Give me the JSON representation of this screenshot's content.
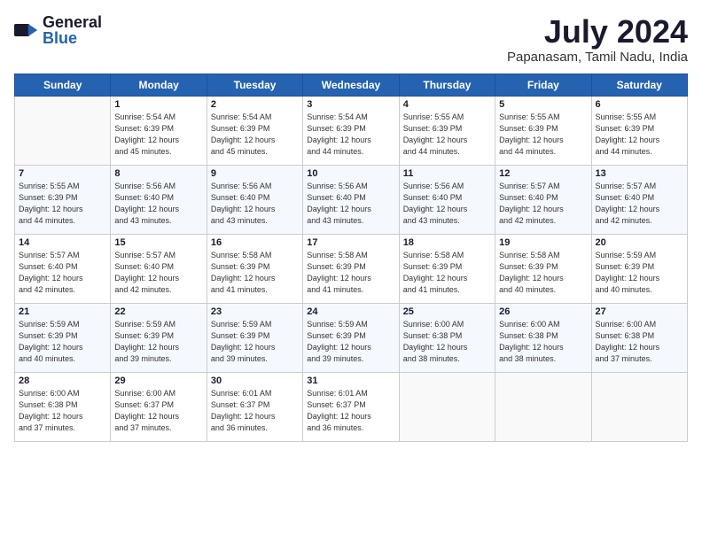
{
  "header": {
    "logo_general": "General",
    "logo_blue": "Blue",
    "month_title": "July 2024",
    "location": "Papanasam, Tamil Nadu, India"
  },
  "days_of_week": [
    "Sunday",
    "Monday",
    "Tuesday",
    "Wednesday",
    "Thursday",
    "Friday",
    "Saturday"
  ],
  "weeks": [
    [
      {
        "day": null
      },
      {
        "day": 1,
        "sunrise": "Sunrise: 5:54 AM",
        "sunset": "Sunset: 6:39 PM",
        "daylight": "Daylight: 12 hours and 45 minutes."
      },
      {
        "day": 2,
        "sunrise": "Sunrise: 5:54 AM",
        "sunset": "Sunset: 6:39 PM",
        "daylight": "Daylight: 12 hours and 45 minutes."
      },
      {
        "day": 3,
        "sunrise": "Sunrise: 5:54 AM",
        "sunset": "Sunset: 6:39 PM",
        "daylight": "Daylight: 12 hours and 44 minutes."
      },
      {
        "day": 4,
        "sunrise": "Sunrise: 5:55 AM",
        "sunset": "Sunset: 6:39 PM",
        "daylight": "Daylight: 12 hours and 44 minutes."
      },
      {
        "day": 5,
        "sunrise": "Sunrise: 5:55 AM",
        "sunset": "Sunset: 6:39 PM",
        "daylight": "Daylight: 12 hours and 44 minutes."
      },
      {
        "day": 6,
        "sunrise": "Sunrise: 5:55 AM",
        "sunset": "Sunset: 6:39 PM",
        "daylight": "Daylight: 12 hours and 44 minutes."
      }
    ],
    [
      {
        "day": 7,
        "sunrise": "Sunrise: 5:55 AM",
        "sunset": "Sunset: 6:39 PM",
        "daylight": "Daylight: 12 hours and 44 minutes."
      },
      {
        "day": 8,
        "sunrise": "Sunrise: 5:56 AM",
        "sunset": "Sunset: 6:40 PM",
        "daylight": "Daylight: 12 hours and 43 minutes."
      },
      {
        "day": 9,
        "sunrise": "Sunrise: 5:56 AM",
        "sunset": "Sunset: 6:40 PM",
        "daylight": "Daylight: 12 hours and 43 minutes."
      },
      {
        "day": 10,
        "sunrise": "Sunrise: 5:56 AM",
        "sunset": "Sunset: 6:40 PM",
        "daylight": "Daylight: 12 hours and 43 minutes."
      },
      {
        "day": 11,
        "sunrise": "Sunrise: 5:56 AM",
        "sunset": "Sunset: 6:40 PM",
        "daylight": "Daylight: 12 hours and 43 minutes."
      },
      {
        "day": 12,
        "sunrise": "Sunrise: 5:57 AM",
        "sunset": "Sunset: 6:40 PM",
        "daylight": "Daylight: 12 hours and 42 minutes."
      },
      {
        "day": 13,
        "sunrise": "Sunrise: 5:57 AM",
        "sunset": "Sunset: 6:40 PM",
        "daylight": "Daylight: 12 hours and 42 minutes."
      }
    ],
    [
      {
        "day": 14,
        "sunrise": "Sunrise: 5:57 AM",
        "sunset": "Sunset: 6:40 PM",
        "daylight": "Daylight: 12 hours and 42 minutes."
      },
      {
        "day": 15,
        "sunrise": "Sunrise: 5:57 AM",
        "sunset": "Sunset: 6:40 PM",
        "daylight": "Daylight: 12 hours and 42 minutes."
      },
      {
        "day": 16,
        "sunrise": "Sunrise: 5:58 AM",
        "sunset": "Sunset: 6:39 PM",
        "daylight": "Daylight: 12 hours and 41 minutes."
      },
      {
        "day": 17,
        "sunrise": "Sunrise: 5:58 AM",
        "sunset": "Sunset: 6:39 PM",
        "daylight": "Daylight: 12 hours and 41 minutes."
      },
      {
        "day": 18,
        "sunrise": "Sunrise: 5:58 AM",
        "sunset": "Sunset: 6:39 PM",
        "daylight": "Daylight: 12 hours and 41 minutes."
      },
      {
        "day": 19,
        "sunrise": "Sunrise: 5:58 AM",
        "sunset": "Sunset: 6:39 PM",
        "daylight": "Daylight: 12 hours and 40 minutes."
      },
      {
        "day": 20,
        "sunrise": "Sunrise: 5:59 AM",
        "sunset": "Sunset: 6:39 PM",
        "daylight": "Daylight: 12 hours and 40 minutes."
      }
    ],
    [
      {
        "day": 21,
        "sunrise": "Sunrise: 5:59 AM",
        "sunset": "Sunset: 6:39 PM",
        "daylight": "Daylight: 12 hours and 40 minutes."
      },
      {
        "day": 22,
        "sunrise": "Sunrise: 5:59 AM",
        "sunset": "Sunset: 6:39 PM",
        "daylight": "Daylight: 12 hours and 39 minutes."
      },
      {
        "day": 23,
        "sunrise": "Sunrise: 5:59 AM",
        "sunset": "Sunset: 6:39 PM",
        "daylight": "Daylight: 12 hours and 39 minutes."
      },
      {
        "day": 24,
        "sunrise": "Sunrise: 5:59 AM",
        "sunset": "Sunset: 6:39 PM",
        "daylight": "Daylight: 12 hours and 39 minutes."
      },
      {
        "day": 25,
        "sunrise": "Sunrise: 6:00 AM",
        "sunset": "Sunset: 6:38 PM",
        "daylight": "Daylight: 12 hours and 38 minutes."
      },
      {
        "day": 26,
        "sunrise": "Sunrise: 6:00 AM",
        "sunset": "Sunset: 6:38 PM",
        "daylight": "Daylight: 12 hours and 38 minutes."
      },
      {
        "day": 27,
        "sunrise": "Sunrise: 6:00 AM",
        "sunset": "Sunset: 6:38 PM",
        "daylight": "Daylight: 12 hours and 37 minutes."
      }
    ],
    [
      {
        "day": 28,
        "sunrise": "Sunrise: 6:00 AM",
        "sunset": "Sunset: 6:38 PM",
        "daylight": "Daylight: 12 hours and 37 minutes."
      },
      {
        "day": 29,
        "sunrise": "Sunrise: 6:00 AM",
        "sunset": "Sunset: 6:37 PM",
        "daylight": "Daylight: 12 hours and 37 minutes."
      },
      {
        "day": 30,
        "sunrise": "Sunrise: 6:01 AM",
        "sunset": "Sunset: 6:37 PM",
        "daylight": "Daylight: 12 hours and 36 minutes."
      },
      {
        "day": 31,
        "sunrise": "Sunrise: 6:01 AM",
        "sunset": "Sunset: 6:37 PM",
        "daylight": "Daylight: 12 hours and 36 minutes."
      },
      {
        "day": null
      },
      {
        "day": null
      },
      {
        "day": null
      }
    ]
  ]
}
